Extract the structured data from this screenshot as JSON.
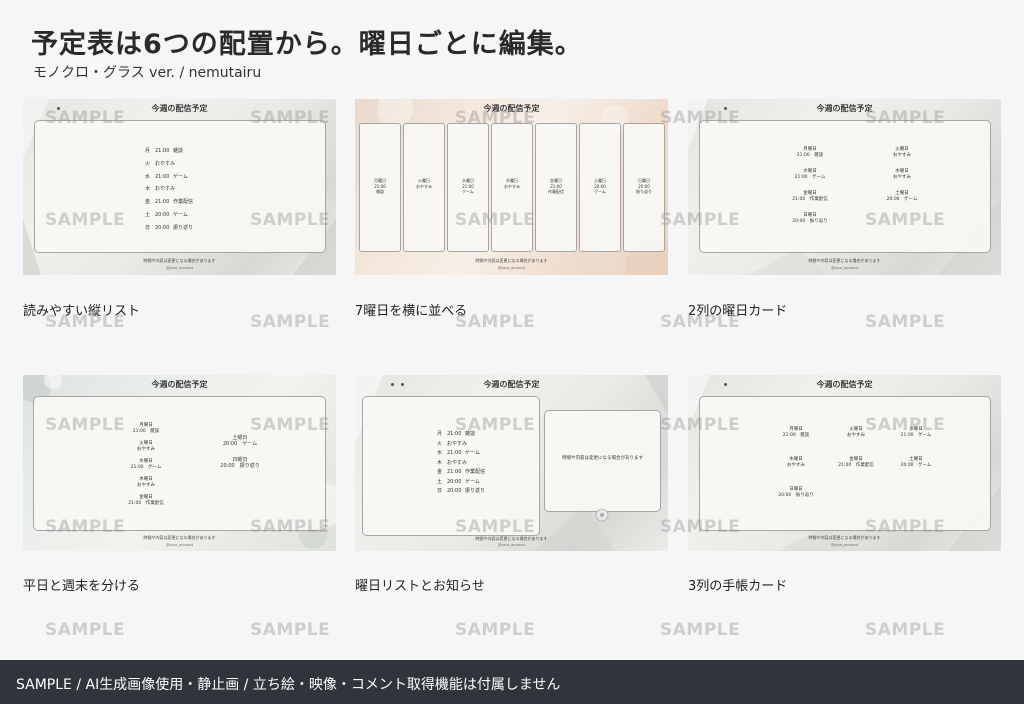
{
  "header": {
    "title": "予定表は6つの配置から。曜日ごとに編集。",
    "subtitle": "モノクロ・グラス ver. / nemutairu"
  },
  "watermark": "SAMPLE",
  "common": {
    "card_title": "今週の配信予定",
    "note": "時間や内容は変更になる場合があります",
    "account": "@your_account"
  },
  "cards": [
    {
      "caption": "読みやすい縦リスト",
      "rows": [
        {
          "day": "月",
          "time": "21:00",
          "event": "雑談"
        },
        {
          "day": "火",
          "time": "",
          "event": "おやすみ"
        },
        {
          "day": "水",
          "time": "21:00",
          "event": "ゲーム"
        },
        {
          "day": "木",
          "time": "",
          "event": "おやすみ"
        },
        {
          "day": "金",
          "time": "21:00",
          "event": "作業配信"
        },
        {
          "day": "土",
          "time": "20:00",
          "event": "ゲーム"
        },
        {
          "day": "日",
          "time": "20:00",
          "event": "振り返り"
        }
      ]
    },
    {
      "caption": "7曜日を横に並べる",
      "columns": [
        {
          "day": "月曜日",
          "time": "21:00",
          "event": "雑談"
        },
        {
          "day": "火曜日",
          "time": "",
          "event": "おやすみ"
        },
        {
          "day": "水曜日",
          "time": "21:00",
          "event": "ゲーム"
        },
        {
          "day": "木曜日",
          "time": "",
          "event": "おやすみ"
        },
        {
          "day": "金曜日",
          "time": "21:00",
          "event": "作業配信"
        },
        {
          "day": "土曜日",
          "time": "20:00",
          "event": "ゲーム"
        },
        {
          "day": "日曜日",
          "time": "20:00",
          "event": "振り返り"
        }
      ]
    },
    {
      "caption": "2列の曜日カード",
      "left": [
        {
          "day": "月曜日",
          "line": "21:00　雑談"
        },
        {
          "day": "水曜日",
          "line": "21:00　ゲーム"
        },
        {
          "day": "金曜日",
          "line": "21:00　作業配信"
        },
        {
          "day": "日曜日",
          "line": "20:00　振り返り"
        }
      ],
      "right": [
        {
          "day": "火曜日",
          "line": "おやすみ"
        },
        {
          "day": "木曜日",
          "line": "おやすみ"
        },
        {
          "day": "土曜日",
          "line": "20:00　ゲーム"
        }
      ]
    },
    {
      "caption": "平日と週末を分ける",
      "weekday": [
        {
          "day": "月曜日",
          "line": "21:00　雑談"
        },
        {
          "day": "火曜日",
          "line": "おやすみ"
        },
        {
          "day": "水曜日",
          "line": "21:00　ゲーム"
        },
        {
          "day": "木曜日",
          "line": "おやすみ"
        },
        {
          "day": "金曜日",
          "line": "21:00　作業配信"
        }
      ],
      "weekend": [
        {
          "day": "土曜日",
          "line": "20:00　ゲーム"
        },
        {
          "day": "日曜日",
          "line": "20:00　振り返り"
        }
      ]
    },
    {
      "caption": "曜日リストとお知らせ",
      "rows": [
        {
          "day": "月",
          "time": "21:00",
          "event": "雑談"
        },
        {
          "day": "火",
          "time": "",
          "event": "おやすみ"
        },
        {
          "day": "水",
          "time": "21:00",
          "event": "ゲーム"
        },
        {
          "day": "木",
          "time": "",
          "event": "おやすみ"
        },
        {
          "day": "金",
          "time": "21:00",
          "event": "作業配信"
        },
        {
          "day": "土",
          "time": "20:00",
          "event": "ゲーム"
        },
        {
          "day": "日",
          "time": "20:00",
          "event": "振り返り"
        }
      ],
      "notice": "時間や内容は変更になる場合があります"
    },
    {
      "caption": "3列の手帳カード",
      "grid": [
        {
          "day": "月曜日",
          "line": "21:00　雑談"
        },
        {
          "day": "火曜日",
          "line": "おやすみ"
        },
        {
          "day": "水曜日",
          "line": "21:00　ゲーム"
        },
        {
          "day": "木曜日",
          "line": "おやすみ"
        },
        {
          "day": "金曜日",
          "line": "21:00　作業配信"
        },
        {
          "day": "土曜日",
          "line": "20:00　ゲーム"
        },
        {
          "day": "日曜日",
          "line": "20:00　振り返り"
        }
      ]
    }
  ],
  "footer": {
    "text": "SAMPLE / AI生成画像使用・静止画 / 立ち絵・映像・コメント取得機能は付属しません"
  },
  "colors": {
    "background": "#f5f6f8",
    "footer_bg": "#30353b",
    "panel_border": "#a6a6a6"
  }
}
